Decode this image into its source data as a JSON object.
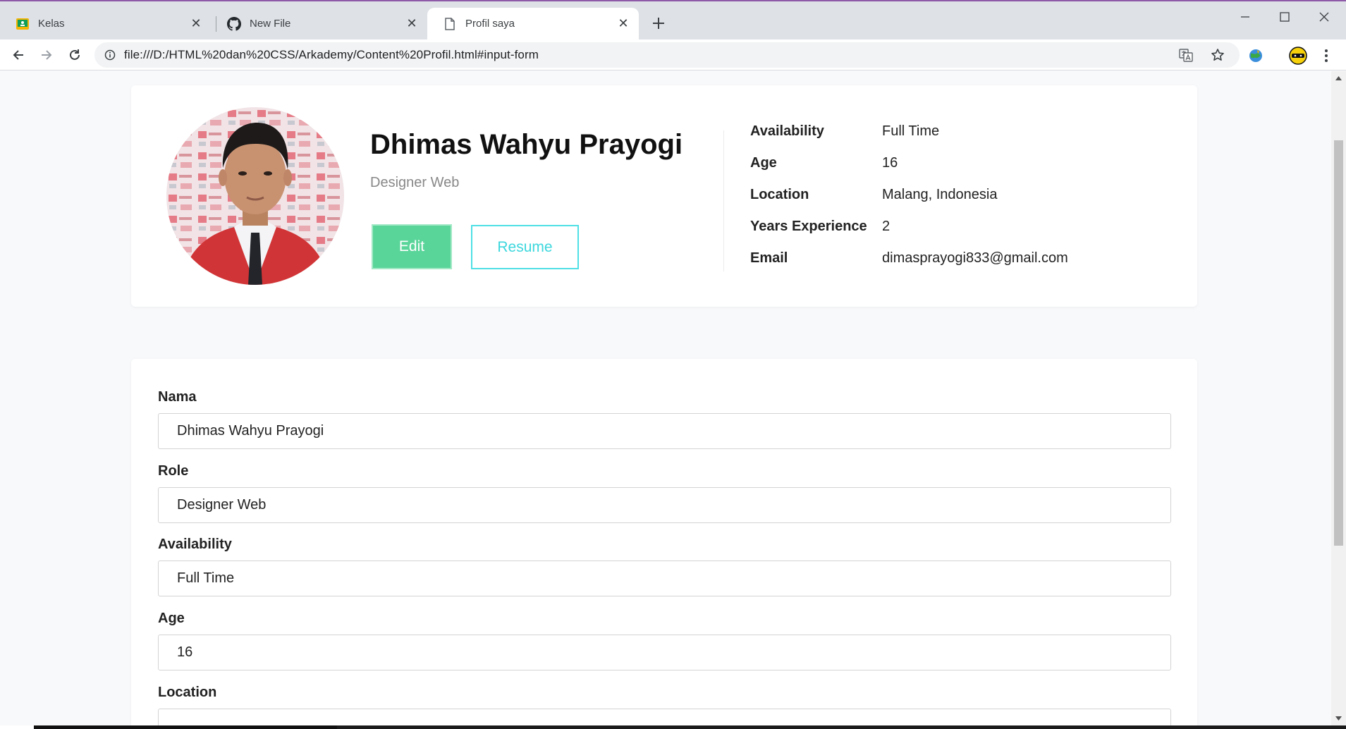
{
  "browser": {
    "tabs": [
      {
        "title": "Kelas",
        "icon": "google-classroom-icon"
      },
      {
        "title": "New File",
        "icon": "github-icon"
      },
      {
        "title": "Profil saya",
        "icon": "document-icon"
      }
    ],
    "url": "file:///D:/HTML%20dan%20CSS/Arkademy/Content%20Profil.html#input-form"
  },
  "profile": {
    "name": "Dhimas Wahyu Prayogi",
    "role": "Designer Web",
    "edit_label": "Edit",
    "resume_label": "Resume",
    "details": [
      {
        "label": "Availability",
        "value": "Full Time"
      },
      {
        "label": "Age",
        "value": "16"
      },
      {
        "label": "Location",
        "value": "Malang, Indonesia"
      },
      {
        "label": "Years Experience",
        "value": "2"
      },
      {
        "label": "Email",
        "value": "dimasprayogi833@gmail.com"
      }
    ]
  },
  "form": {
    "fields": [
      {
        "label": "Nama",
        "value": "Dhimas Wahyu Prayogi"
      },
      {
        "label": "Role",
        "value": "Designer Web"
      },
      {
        "label": "Availability",
        "value": "Full Time"
      },
      {
        "label": "Age",
        "value": "16"
      },
      {
        "label": "Location",
        "value": ""
      }
    ]
  },
  "colors": {
    "edit_button": "#5ad59a",
    "resume_border": "#4fe0e5",
    "page_background": "#f8f9fb"
  }
}
